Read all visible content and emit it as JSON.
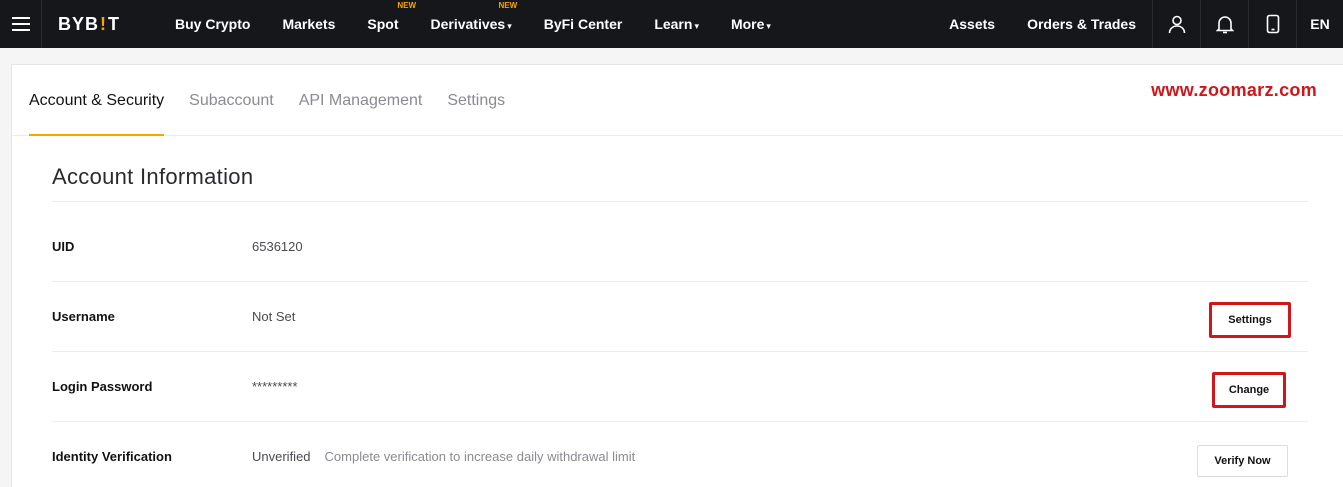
{
  "topnav": {
    "logo": {
      "left": "BYB",
      "bar": "!",
      "right": "T"
    },
    "items": [
      {
        "label": "Buy Crypto",
        "badge": "",
        "caret": ""
      },
      {
        "label": "Markets",
        "badge": "",
        "caret": ""
      },
      {
        "label": "Spot",
        "badge": "NEW",
        "caret": ""
      },
      {
        "label": "Derivatives",
        "badge": "NEW",
        "caret": "▾"
      },
      {
        "label": "ByFi Center",
        "badge": "",
        "caret": ""
      },
      {
        "label": "Learn",
        "badge": "",
        "caret": "▾"
      },
      {
        "label": "More",
        "badge": "",
        "caret": "▾"
      }
    ],
    "assets_label": "Assets",
    "orders_label": "Orders & Trades",
    "icons": [
      "user-icon",
      "bell-icon",
      "phone-icon"
    ],
    "language": "EN",
    "accent_color": "#f7a600"
  },
  "tabs": [
    {
      "label": "Account & Security",
      "active": true
    },
    {
      "label": "Subaccount",
      "active": false
    },
    {
      "label": "API Management",
      "active": false
    },
    {
      "label": "Settings",
      "active": false
    }
  ],
  "watermark": "www.zoomarz.com",
  "account": {
    "title": "Account Information",
    "rows": [
      {
        "label": "UID",
        "value": "6536120",
        "hint": "",
        "button": ""
      },
      {
        "label": "Username",
        "value": "Not Set",
        "hint": "",
        "button": "Settings"
      },
      {
        "label": "Login Password",
        "value": "*********",
        "hint": "",
        "button": "Change"
      },
      {
        "label": "Identity Verification",
        "value": "Unverified",
        "hint": "Complete verification to increase daily withdrawal limit",
        "button": "Verify Now"
      }
    ]
  },
  "highlight_color": "#d1161b"
}
